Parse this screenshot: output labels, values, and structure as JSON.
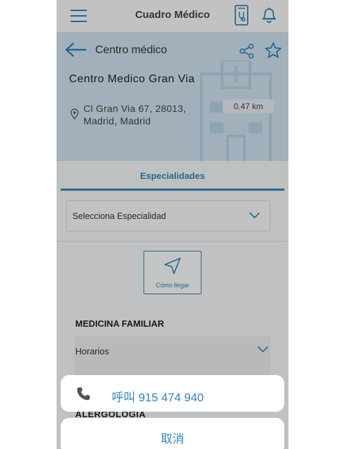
{
  "app": {
    "title": "Cuadro Médico"
  },
  "header": {
    "section_title": "Centro médico"
  },
  "center": {
    "name": "Centro Medico Gran Via",
    "address_line1": "Cl Gran Via 67, 28013,",
    "address_line2": "Madrid, Madrid",
    "distance": "0.47 km"
  },
  "tabs": [
    {
      "label": "Especialidades",
      "active": true
    }
  ],
  "specialty_select": {
    "placeholder": "Selecciona Especialidad"
  },
  "directions": {
    "label": "Cómo llegar"
  },
  "specialties": [
    {
      "name": "MEDICINA FAMILIAR",
      "hours_label": "Horarios"
    },
    {
      "name": "ALERGOLOGIA"
    }
  ],
  "action_sheet": {
    "call_label": "呼叫 915 474 940",
    "cancel_label": "取消"
  },
  "icons": {
    "menu": "menu-icon",
    "medical_record": "medical-record-icon",
    "bell": "bell-icon",
    "back": "back-arrow-icon",
    "share": "share-icon",
    "star": "star-icon",
    "pin": "location-pin-icon",
    "chevron": "chevron-down-icon",
    "navigation": "navigation-arrow-icon",
    "phone": "phone-icon"
  },
  "colors": {
    "accent": "#2f86b8",
    "hero_bg": "#cfe2ef",
    "overlay": "rgba(0,0,0,0.22)"
  }
}
